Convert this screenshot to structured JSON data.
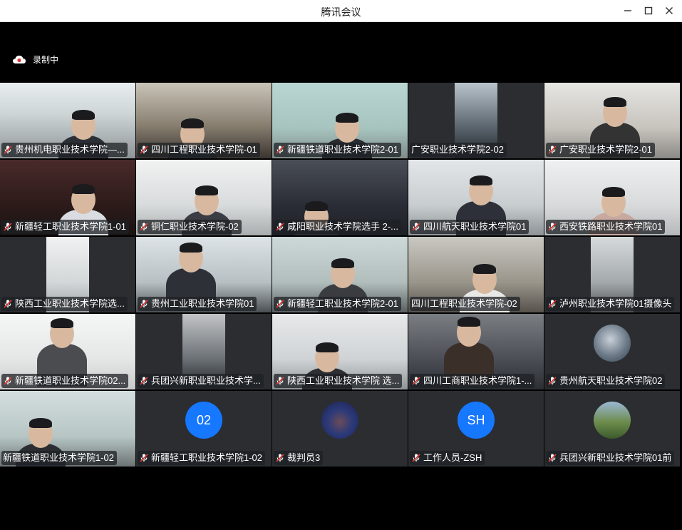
{
  "window": {
    "title": "腾讯会议",
    "min_icon": "—",
    "max_icon": "☐",
    "close_icon": "✕"
  },
  "recording": {
    "label": "录制中",
    "icon": "cloud-record-icon"
  },
  "tiles": [
    {
      "name": "贵州机电职业技术学院—...",
      "muted": true
    },
    {
      "name": "四川工程职业技术学院-01",
      "muted": true
    },
    {
      "name": "新疆铁道职业技术学院2-01",
      "muted": true
    },
    {
      "name": "广安职业技术学院2-02",
      "muted": false
    },
    {
      "name": "广安职业技术学院2-01",
      "muted": true
    },
    {
      "name": "新疆轻工职业技术学院1-01",
      "muted": true
    },
    {
      "name": "铜仁职业技术学院-02",
      "muted": true
    },
    {
      "name": "咸阳职业技术学院选手 2-...",
      "muted": true
    },
    {
      "name": "四川航天职业技术学院01",
      "muted": true
    },
    {
      "name": "西安铁路职业技术学院01",
      "muted": true
    },
    {
      "name": "陕西工业职业技术学院选...",
      "muted": true
    },
    {
      "name": "贵州工业职业技术学院01",
      "muted": true
    },
    {
      "name": "新疆轻工职业技术学院2-01",
      "muted": true
    },
    {
      "name": "四川工程职业技术学院-02",
      "muted": false
    },
    {
      "name": "泸州职业技术学院01摄像头",
      "muted": true
    },
    {
      "name": "新疆铁道职业技术学院02...",
      "muted": true
    },
    {
      "name": "兵团兴新职业职业技术学...",
      "muted": true
    },
    {
      "name": "陕西工业职业技术学院 选...",
      "muted": true
    },
    {
      "name": "四川工商职业技术学院1-...",
      "muted": true
    },
    {
      "name": "贵州航天职业技术学院02",
      "muted": true
    },
    {
      "name": "新疆铁道职业技术学院1-02",
      "muted": false
    },
    {
      "name": "新疆轻工职业技术学院1-02",
      "muted": true,
      "avatar_text": "02"
    },
    {
      "name": "裁判员3",
      "muted": true
    },
    {
      "name": "工作人员-ZSH",
      "muted": true,
      "avatar_text": "SH"
    },
    {
      "name": "兵团兴新职业技术学院01前",
      "muted": true
    }
  ]
}
